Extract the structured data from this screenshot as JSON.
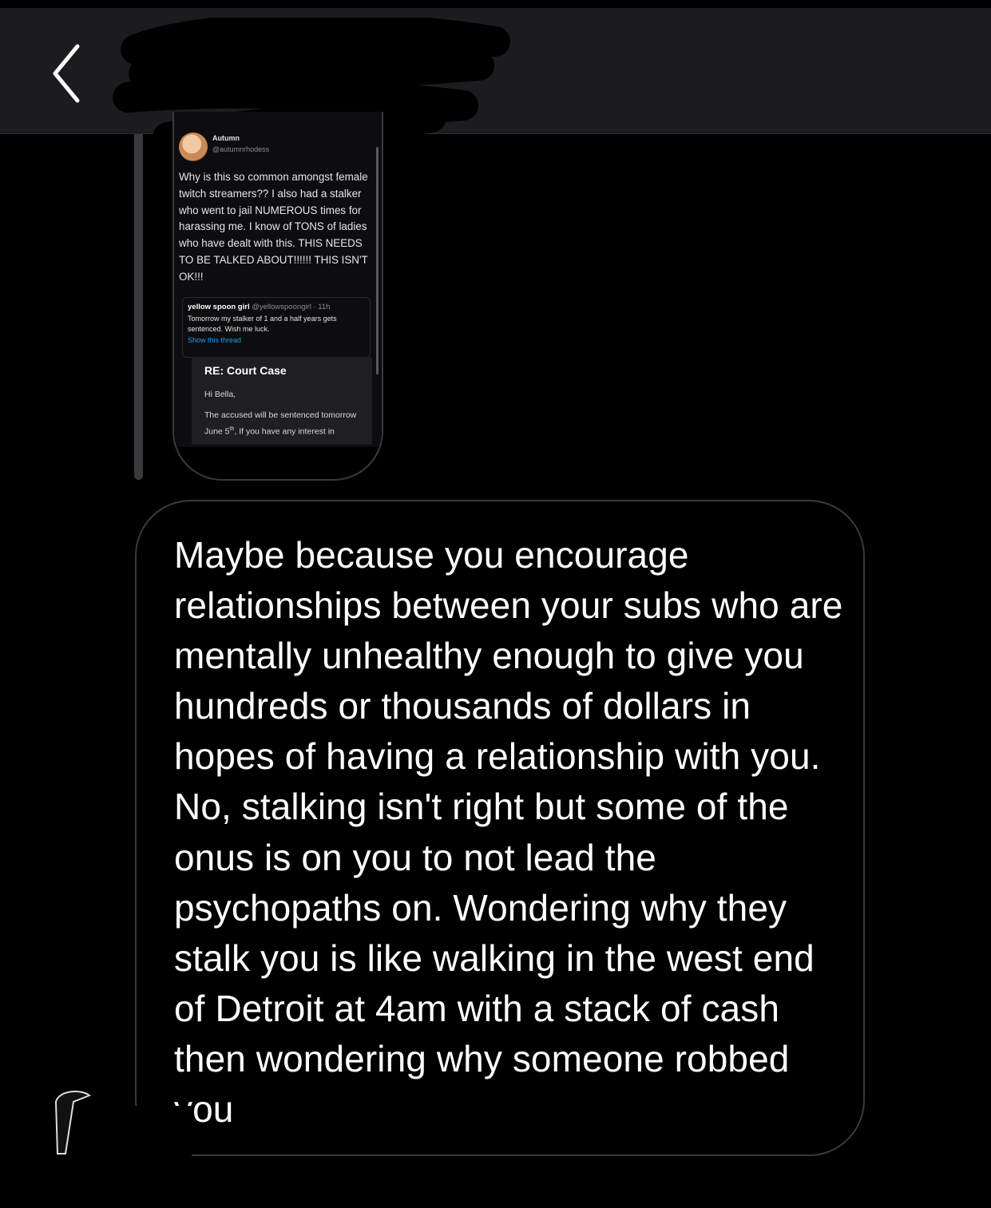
{
  "header": {
    "back_icon": "chevron-left-icon",
    "avatar_icon": "profile-avatar"
  },
  "shared_post": {
    "author_name": "Autumn",
    "author_handle": "@autumnrhodess",
    "body": "Why is this so common amongst female twitch streamers?? I also had a stalker who went to jail NUMEROUS times for harassing me. I know of TONS of ladies who have dealt with this. THIS NEEDS TO BE TALKED ABOUT!!!!!! THIS ISN'T OK!!!",
    "quote": {
      "name": "yellow spoon girl",
      "handle_time": "@yellowspoongirl · 11h",
      "text": "Tomorrow my stalker of 1 and a half years gets sentenced. Wish me luck.",
      "link": "Show this thread"
    },
    "email": {
      "subject": "RE:  Court Case",
      "greeting": "Hi Bella,",
      "text_a": "The accused will be sentenced tomorrow June 5",
      "text_sup": "th",
      "text_b": ", If you have any interest in"
    }
  },
  "message": {
    "text": "Maybe because you encourage relationships between your subs who are mentally unhealthy enough to give you hundreds or thousands of dollars in hopes of having a relationship with you. No, stalking isn't right but some of the onus is on you to not lead the psychopaths on. Wondering why they stalk you is like walking in the west end of Detroit at 4am with a stack of cash then wondering why someone robbed you"
  }
}
